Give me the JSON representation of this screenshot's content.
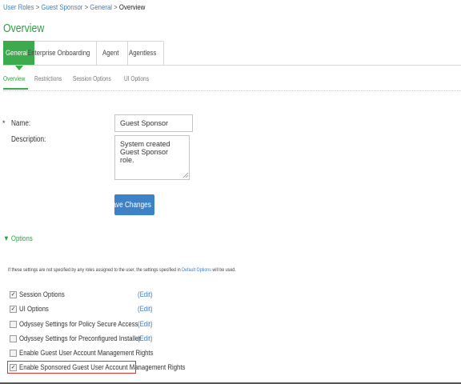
{
  "breadcrumb": {
    "items": [
      "User Roles",
      "Guest Sponsor",
      "General"
    ],
    "separator": ">",
    "current": "Overview"
  },
  "page_title": "Overview",
  "main_tabs": [
    {
      "label": "General",
      "active": true
    },
    {
      "label": "Enterprise Onboarding",
      "active": false
    },
    {
      "label": "Agent",
      "active": false
    },
    {
      "label": "Agentless",
      "active": false
    }
  ],
  "sub_tabs": [
    {
      "label": "Overview",
      "active": true
    },
    {
      "label": "Restrictions",
      "active": false
    },
    {
      "label": "Session Options",
      "active": false
    },
    {
      "label": "UI Options",
      "active": false
    }
  ],
  "form": {
    "required_marker": "*",
    "name_label": "Name:",
    "name_value": "Guest Sponsor",
    "description_label": "Description:",
    "description_value": "System created Guest Sponsor role.",
    "save_label": "Save Changes"
  },
  "options": {
    "header": "Options",
    "note_prefix": "If these settings are not specified by any roles assigned to the user, the settings specified in",
    "note_link": "Default Options",
    "note_suffix": "will be used.",
    "items": [
      {
        "label": "Session Options",
        "checked": true,
        "edit": "(Edit)"
      },
      {
        "label": "UI Options",
        "checked": true,
        "edit": "(Edit)"
      },
      {
        "label": "Odyssey Settings for Policy Secure Access",
        "checked": false,
        "edit": "(Edit)"
      },
      {
        "label": "Odyssey Settings for Preconfigured Installer",
        "checked": false,
        "edit": "(Edit)"
      },
      {
        "label": "Enable Guest User Account Management Rights",
        "checked": false,
        "edit": ""
      },
      {
        "label": "Enable Sponsored Guest User Account Management Rights",
        "checked": true,
        "edit": ""
      }
    ]
  },
  "colors": {
    "accent_green": "#3bab4d",
    "link_blue": "#3a80c4",
    "button_blue": "#3d82c6",
    "highlight_red": "#d9362c"
  }
}
